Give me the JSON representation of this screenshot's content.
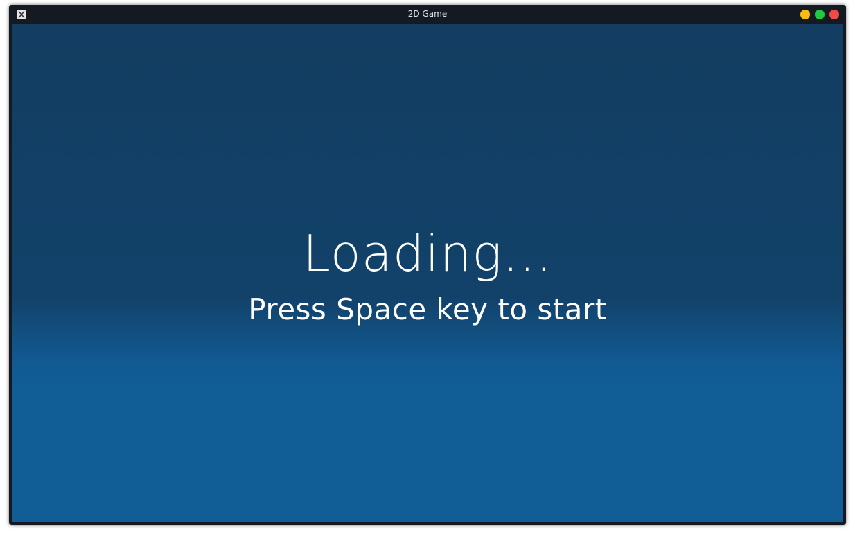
{
  "window": {
    "title": "2D Game",
    "app_icon": "x-window-icon",
    "controls": {
      "minimize": {
        "icon": "minimize-icon",
        "color": "#f7bd14"
      },
      "maximize": {
        "icon": "maximize-icon",
        "color": "#1fc943"
      },
      "close": {
        "icon": "close-icon",
        "color": "#ee4b4b"
      }
    }
  },
  "game": {
    "loading_text": "Loading...",
    "hint_text": "Press Space key to start",
    "colors": {
      "background_top": "#133d61",
      "background_bottom": "#115e97",
      "text": "#ffffff"
    }
  }
}
